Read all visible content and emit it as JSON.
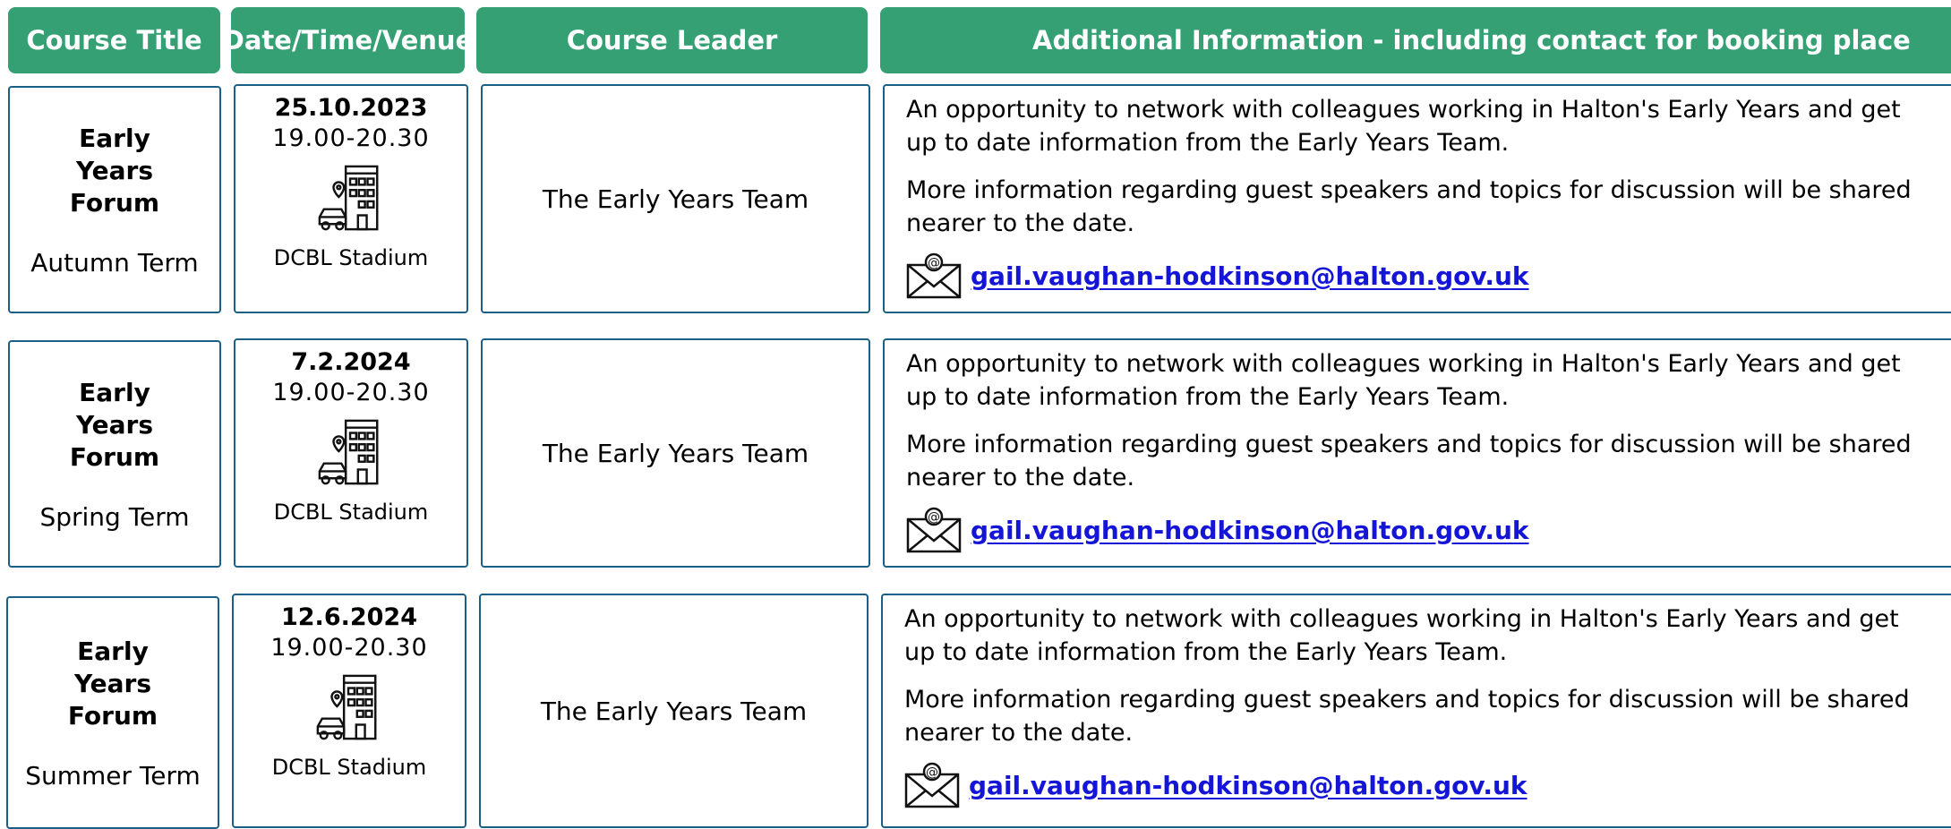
{
  "headers": {
    "title": "Course Title",
    "date": "Date/Time/Venue",
    "leader": "Course Leader",
    "info": "Additional Information - including contact for booking place"
  },
  "rows": [
    {
      "course": "Early Years Forum",
      "term": "Autumn Term",
      "date": "25.10.2023",
      "time": "19.00-20.30",
      "venue": "DCBL Stadium",
      "leader": "The Early Years Team",
      "info1": "An opportunity to network with colleagues working in Halton's Early Years and get up to date information from the Early Years Team.",
      "info2": "More information regarding guest speakers and topics for discussion will be shared nearer to the date.",
      "email": "gail.vaughan-hodkinson@halton.gov.uk"
    },
    {
      "course": "Early Years Forum",
      "term": "Spring Term",
      "date": "7.2.2024",
      "time": "19.00-20.30",
      "venue": "DCBL Stadium",
      "leader": "The Early Years Team",
      "info1": "An opportunity to network with colleagues working in Halton's Early Years and get up to date information from the Early Years Team.",
      "info2": "More information regarding guest speakers and topics for discussion will be shared nearer to the date.",
      "email": "gail.vaughan-hodkinson@halton.gov.uk"
    },
    {
      "course": "Early Years Forum",
      "term": "Summer Term",
      "date": "12.6.2024",
      "time": "19.00-20.30",
      "venue": "DCBL Stadium",
      "leader": "The Early Years Team",
      "info1": "An opportunity to network with colleagues working in Halton's Early Years and get up to date information from the Early Years Team.",
      "info2": "More information regarding guest speakers and topics for discussion will be shared nearer to the date.",
      "email": "gail.vaughan-hodkinson@halton.gov.uk"
    }
  ],
  "icons": {
    "venue": "building-car-location-icon",
    "contact": "email-envelope-icon"
  },
  "colors": {
    "header_bg": "#36a075",
    "border": "#1b5f86",
    "link": "#1515d8"
  }
}
